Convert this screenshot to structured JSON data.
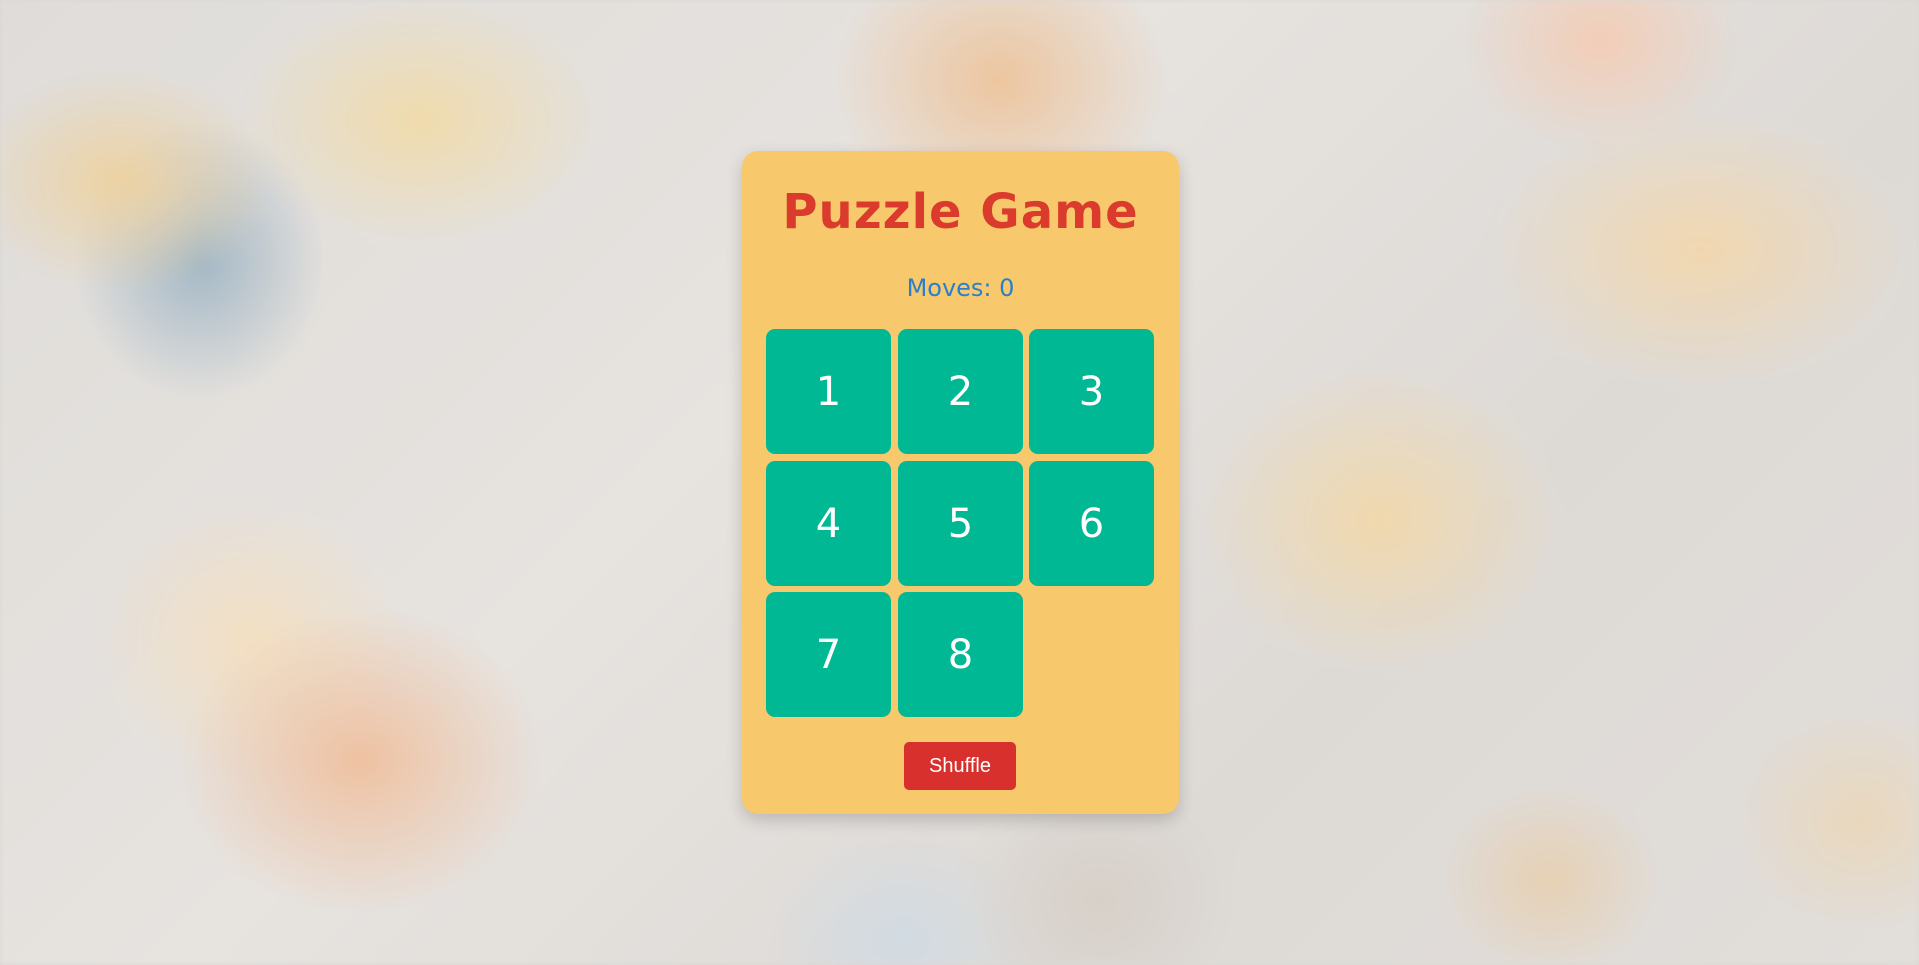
{
  "game": {
    "title": "Puzzle Game",
    "moves_text": "Moves: 0",
    "moves": 0,
    "tiles": [
      "1",
      "2",
      "3",
      "4",
      "5",
      "6",
      "7",
      "8",
      ""
    ],
    "shuffle_label": "Shuffle"
  },
  "colors": {
    "card": "#f7c96c",
    "title": "#db3b2c",
    "moves": "#2a7fcc",
    "tile": "#00b893",
    "tile_text": "#ffffff",
    "shuffle_button": "#d8302d"
  }
}
